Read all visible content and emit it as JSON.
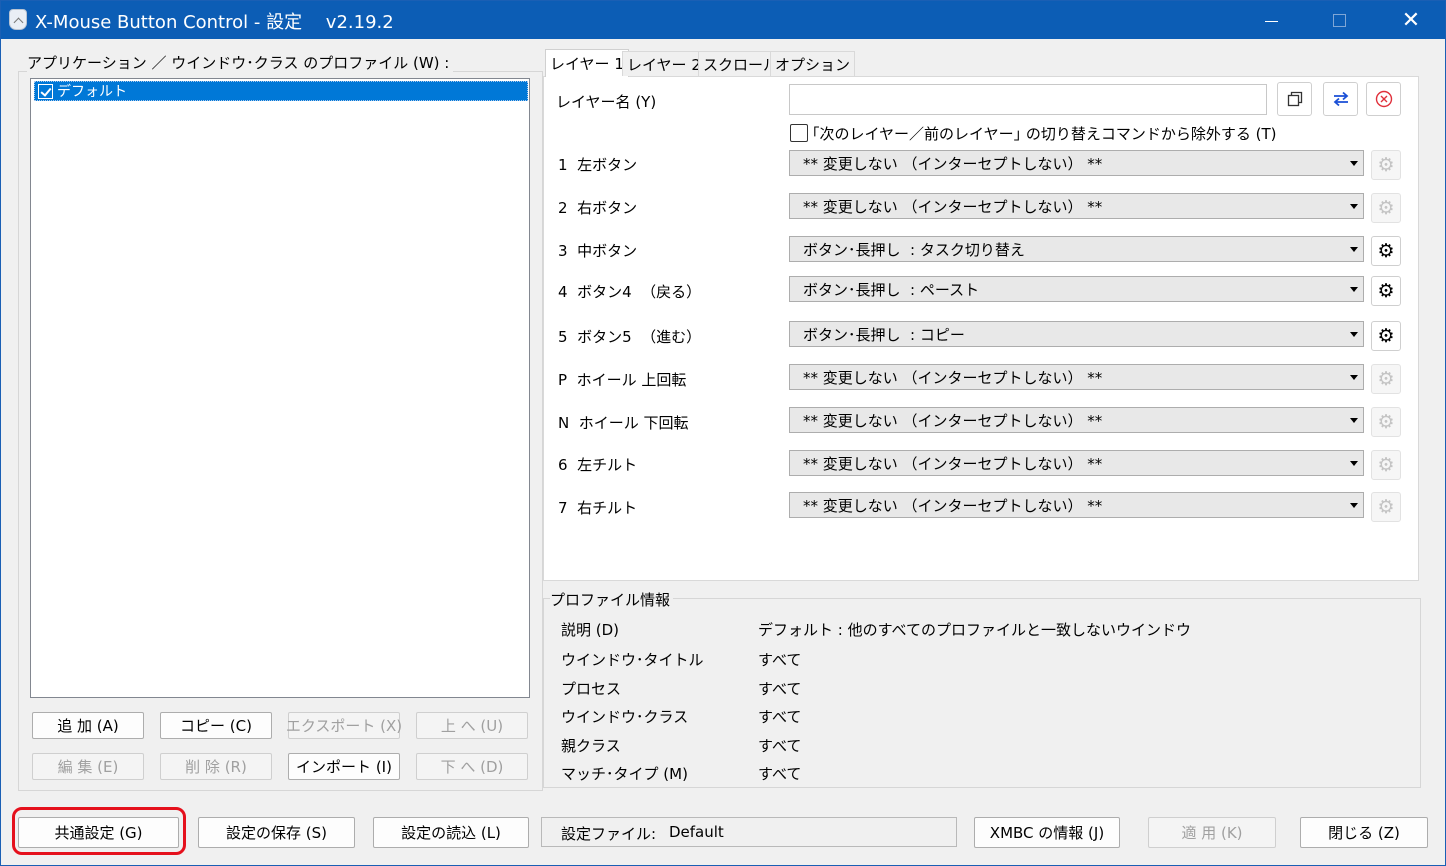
{
  "window": {
    "title": "X-Mouse Button Control - 設定　 v2.19.2",
    "minimize_label": "—",
    "close_label": "✕"
  },
  "profiles": {
    "group_label": "アプリケーション ／ ウインドウ･クラス のプロファイル (W) :",
    "items": [
      {
        "label": "デフォルト",
        "checked": true,
        "selected": true
      }
    ],
    "buttons": {
      "add": "追 加 (A)",
      "copy": "コピー (C)",
      "export": "エクスポート (X)",
      "up": "上 へ (U)",
      "edit": "編 集 (E)",
      "delete": "削 除 (R)",
      "import": "インポート (I)",
      "down": "下 へ (D)"
    }
  },
  "tabs": [
    {
      "label": "レイヤー 1",
      "active": true
    },
    {
      "label": "レイヤー 2",
      "active": false
    },
    {
      "label": "スクロール",
      "active": false
    },
    {
      "label": "オプション",
      "active": false
    }
  ],
  "layer": {
    "name_label": "レイヤー名 (Y)",
    "name_value": "",
    "exclude_label": "｢次のレイヤー／前のレイヤー｣ の切り替えコマンドから除外する (T)",
    "exclude_checked": false,
    "rows": [
      {
        "label": "1  左ボタン",
        "value": "** 変更しない （インターセプトしない） **",
        "gear_active": false
      },
      {
        "label": "2  右ボタン",
        "value": "** 変更しない （インターセプトしない） **",
        "gear_active": false
      },
      {
        "label": "3  中ボタン",
        "value": "ボタン･長押し  : タスク切り替え",
        "gear_active": true
      },
      {
        "label": "4  ボタン4  （戻る）",
        "value": "ボタン･長押し  : ペースト",
        "gear_active": true
      },
      {
        "label": "5  ボタン5  （進む）",
        "value": "ボタン･長押し  : コピー",
        "gear_active": true
      },
      {
        "label": "P  ホイール 上回転",
        "value": "** 変更しない （インターセプトしない） **",
        "gear_active": false
      },
      {
        "label": "N  ホイール 下回転",
        "value": "** 変更しない （インターセプトしない） **",
        "gear_active": false
      },
      {
        "label": "6  左チルト",
        "value": "** 変更しない （インターセプトしない） **",
        "gear_active": false
      },
      {
        "label": "7  右チルト",
        "value": "** 変更しない （インターセプトしない） **",
        "gear_active": false
      }
    ]
  },
  "profile_info": {
    "group_label": "プロファイル情報",
    "rows": [
      {
        "label": "説明 (D)",
        "value": "デフォルト : 他のすべてのプロファイルと一致しないウインドウ"
      },
      {
        "label": "ウインドウ･タイトル",
        "value": "すべて"
      },
      {
        "label": "プロセス",
        "value": "すべて"
      },
      {
        "label": "ウインドウ･クラス",
        "value": "すべて"
      },
      {
        "label": "親クラス",
        "value": "すべて"
      },
      {
        "label": "マッチ･タイプ (M)",
        "value": "すべて"
      }
    ]
  },
  "footer": {
    "common_settings": "共通設定 (G)",
    "save_settings": "設定の保存 (S)",
    "load_settings": "設定の読込 (L)",
    "settings_file_label": "設定ファイル:",
    "settings_file_value": "Default",
    "about": "XMBC の情報 (J)",
    "apply": "適 用 (K)",
    "close": "閉じる (Z)"
  },
  "colors": {
    "titlebar": "#0c5db5",
    "selection": "#0078d7",
    "highlight_ring": "#e5101c"
  },
  "icons": {
    "copy_layer": "copy-icon",
    "swap_layer": "swap-arrows-icon",
    "clear_layer": "clear-circle-icon",
    "row_settings": "gear-icon"
  }
}
